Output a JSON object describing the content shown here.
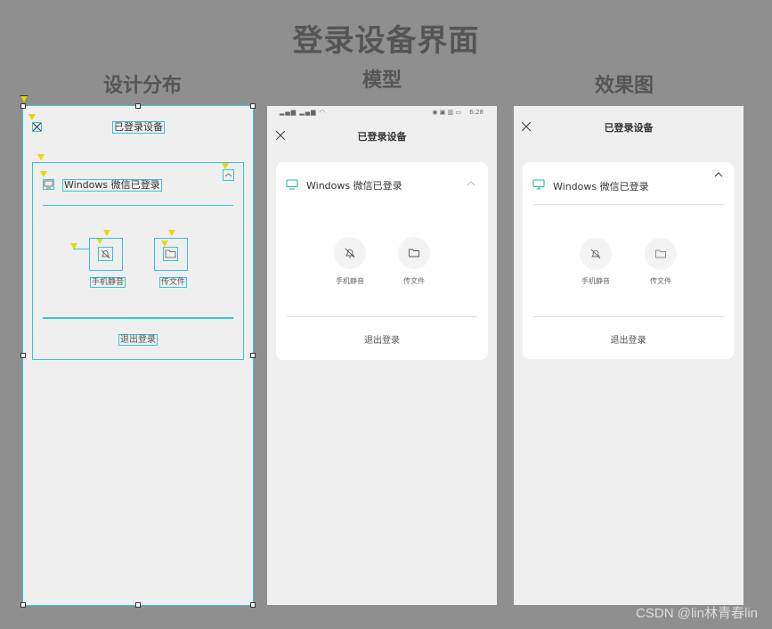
{
  "page": {
    "main_title": "登录设备界面",
    "columns": [
      {
        "label": "设计分布"
      },
      {
        "label": "模型"
      },
      {
        "label": "效果图"
      }
    ],
    "watermark": "CSDN @lin林青春lin"
  },
  "screen": {
    "header_title": "已登录设备",
    "device_name": "Windows 微信已登录",
    "actions": [
      {
        "label": "手机静音",
        "icon": "bell-muted-icon"
      },
      {
        "label": "传文件",
        "icon": "folder-icon"
      }
    ],
    "logout_label": "退出登录",
    "status_time": "6:28"
  },
  "colors": {
    "background": "#8f8f8f",
    "panel": "#efefef",
    "card": "#ffffff",
    "wireframe": "#33c6d6",
    "monitor_icon": "#2bb5a5",
    "title_text": "#555555"
  }
}
